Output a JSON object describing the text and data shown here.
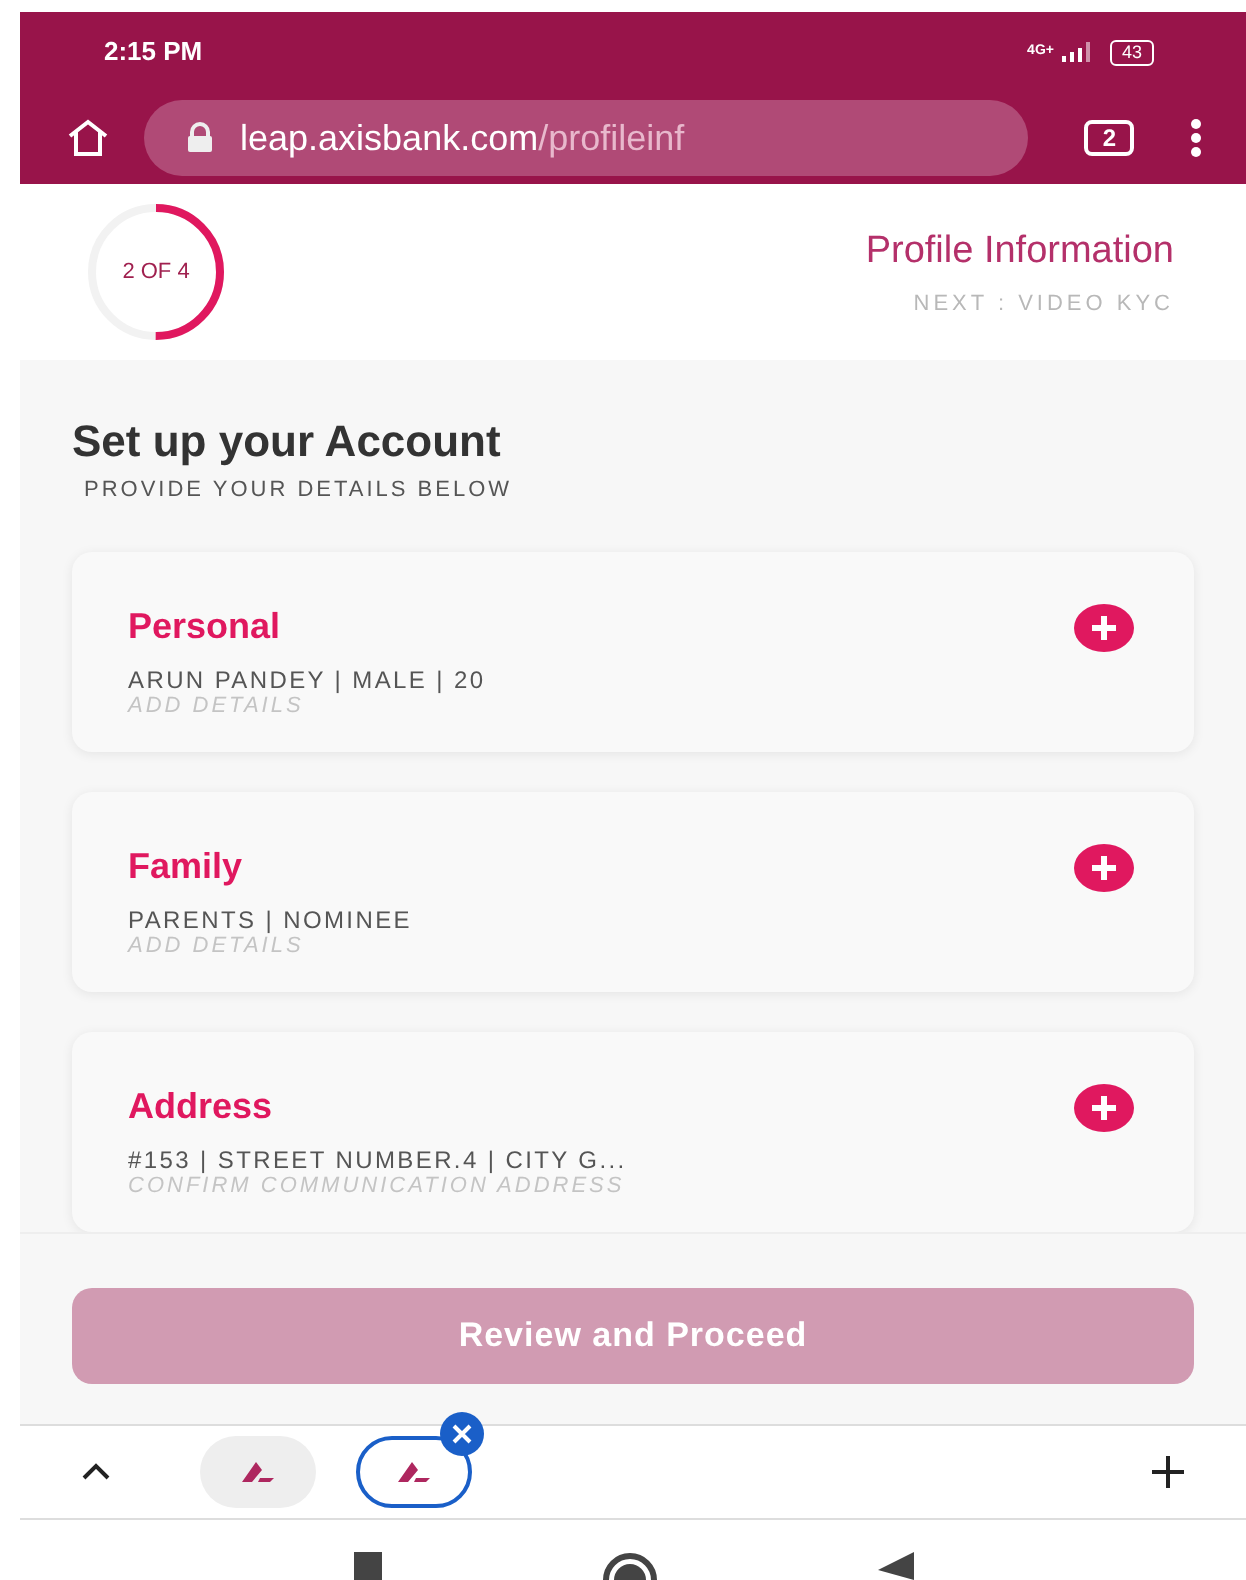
{
  "status_bar": {
    "time": "2:15 PM",
    "network": "4G+",
    "battery": "43"
  },
  "browser": {
    "url_host": "leap.axisbank.com",
    "url_path": "/profileinf",
    "tab_count": "2"
  },
  "progress": {
    "label": "2 OF 4",
    "level": 0.5,
    "title": "Profile Information",
    "next": "NEXT : VIDEO KYC"
  },
  "heading": "Set up your Account",
  "subheading": "PROVIDE YOUR DETAILS BELOW",
  "sections": [
    {
      "title": "Personal",
      "summary": "ARUN PANDEY | MALE | 20",
      "hint": "ADD DETAILS"
    },
    {
      "title": "Family",
      "summary": "PARENTS | NOMINEE",
      "hint": "ADD DETAILS"
    },
    {
      "title": "Address",
      "summary": "#153 | STREET NUMBER.4 | CITY G...",
      "hint": "CONFIRM COMMUNICATION ADDRESS"
    }
  ],
  "primary_button": {
    "label": "Review and Proceed",
    "disabled": true
  },
  "tab_strip": [
    {
      "selected": false
    },
    {
      "selected": true
    }
  ]
}
